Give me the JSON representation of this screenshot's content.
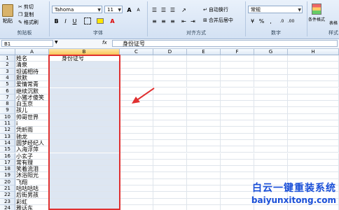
{
  "ribbon": {
    "clipboard": {
      "paste": "粘贴",
      "cut": "剪切",
      "copy": "复制",
      "format_painter": "格式刷",
      "group_label": "剪贴板"
    },
    "font": {
      "name": "Tahoma",
      "size": "11",
      "bold": "B",
      "italic": "I",
      "underline": "U",
      "grow": "A",
      "shrink": "A",
      "font_color": "A",
      "group_label": "字体"
    },
    "alignment": {
      "wrap_text": "自动换行",
      "merge_center": "合并后居中",
      "group_label": "对齐方式"
    },
    "number": {
      "format": "常规",
      "percent": "%",
      "comma": ",",
      "group_label": "数字"
    },
    "styles": {
      "conditional_format": "条件格式",
      "table_format": "表格",
      "group_label": "样式"
    }
  },
  "formula_bar": {
    "cell_ref": "B1",
    "fx": "fx",
    "content": "身份证号"
  },
  "columns": [
    "A",
    "B",
    "C",
    "D",
    "E",
    "F",
    "G",
    "H"
  ],
  "rows": [
    {
      "n": "1",
      "a": "姓名",
      "b": "身份证号"
    },
    {
      "n": "2",
      "a": "清泉",
      "b": ""
    },
    {
      "n": "3",
      "a": "坦诚相待",
      "b": ""
    },
    {
      "n": "4",
      "a": "默默",
      "b": ""
    },
    {
      "n": "5",
      "a": "爱情常青",
      "b": ""
    },
    {
      "n": "6",
      "a": "继续沉默",
      "b": ""
    },
    {
      "n": "7",
      "a": "小猪才傻笑",
      "b": ""
    },
    {
      "n": "8",
      "a": "白玉京",
      "b": ""
    },
    {
      "n": "9",
      "a": "孩儿",
      "b": ""
    },
    {
      "n": "10",
      "a": "帅哥世界",
      "b": ""
    },
    {
      "n": "11",
      "a": "i",
      "b": ""
    },
    {
      "n": "12",
      "a": "凭昕雨",
      "b": ""
    },
    {
      "n": "13",
      "a": "驰龙",
      "b": ""
    },
    {
      "n": "14",
      "a": "圆梦经纪人",
      "b": ""
    },
    {
      "n": "15",
      "a": "入海浮萍",
      "b": ""
    },
    {
      "n": "16",
      "a": "小玄子",
      "b": ""
    },
    {
      "n": "17",
      "a": "常有理",
      "b": ""
    },
    {
      "n": "18",
      "a": "笑着流泪",
      "b": ""
    },
    {
      "n": "19",
      "a": "沐浴阳光",
      "b": ""
    },
    {
      "n": "20",
      "a": "飞翔",
      "b": ""
    },
    {
      "n": "21",
      "a": "咕咕咕咕",
      "b": ""
    },
    {
      "n": "22",
      "a": "后街男孩",
      "b": ""
    },
    {
      "n": "23",
      "a": "彩虹",
      "b": ""
    },
    {
      "n": "24",
      "a": "雅话东",
      "b": ""
    }
  ],
  "watermark": {
    "title": "白云一键重装系统",
    "url": "baiyunxitong.com"
  },
  "colors": {
    "selection_box": "#e03030",
    "watermark": "#1a4fd8",
    "arrow": "#e03030"
  }
}
